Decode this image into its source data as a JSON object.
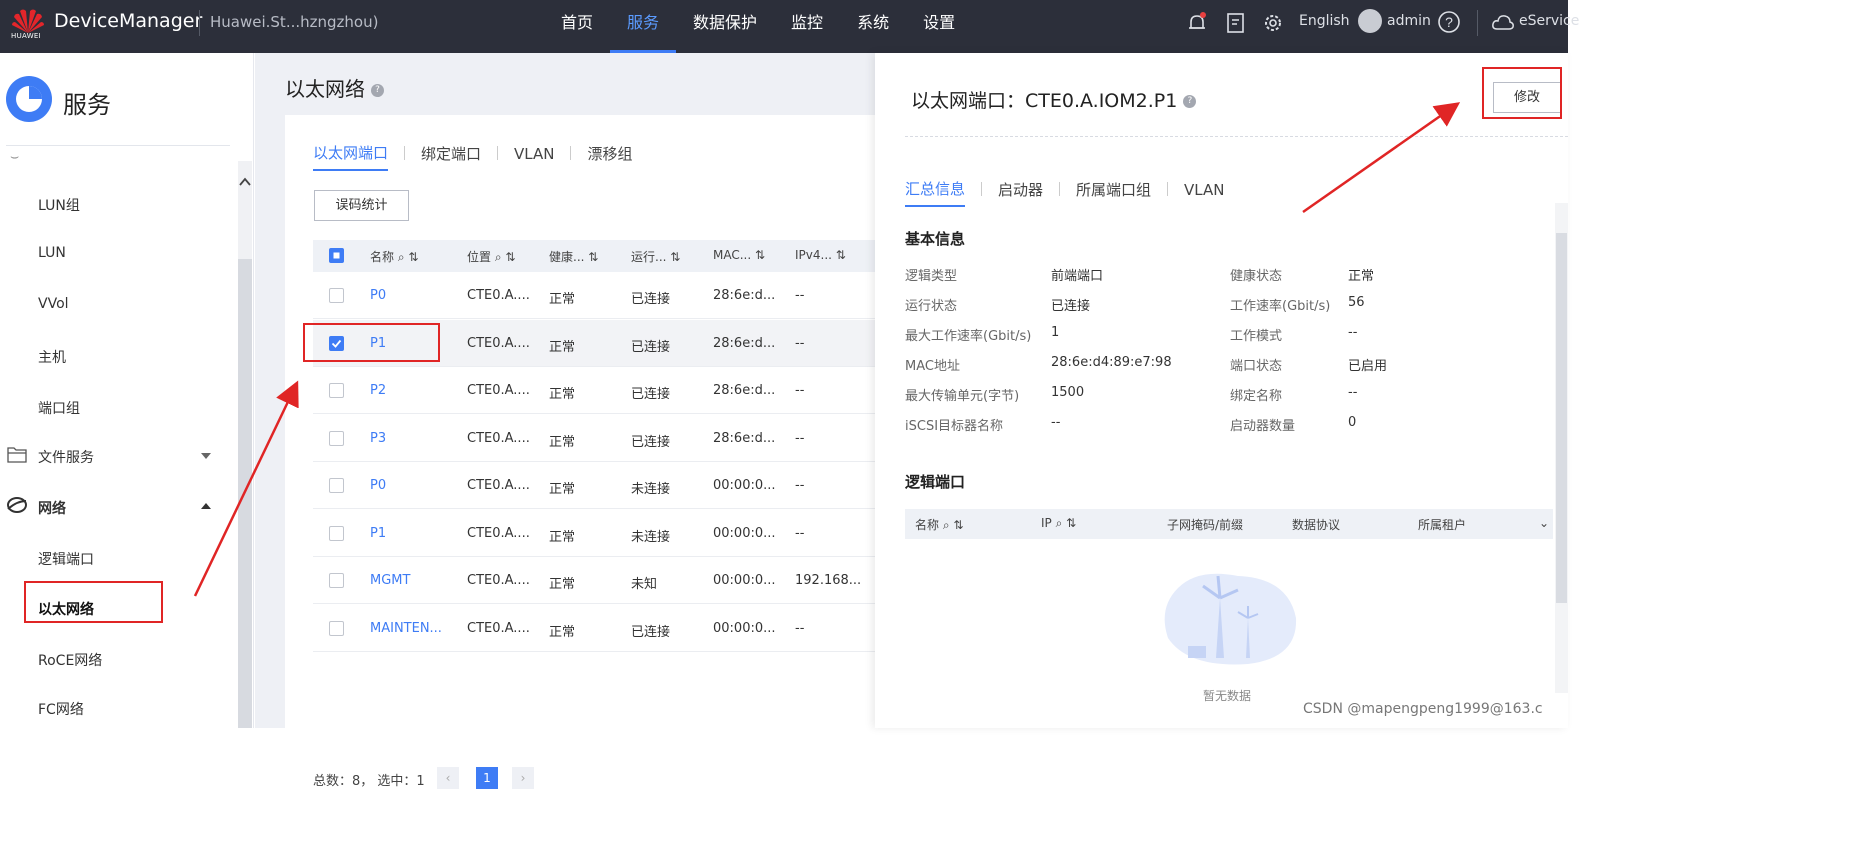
{
  "topbar": {
    "brand": "HUAWEI",
    "app_title": "DeviceManager",
    "device_name": "Huawei.St...hzngzhou)",
    "nav": [
      "首页",
      "服务",
      "数据保护",
      "监控",
      "系统",
      "设置"
    ],
    "active_nav": "服务",
    "language": "English",
    "user": "admin",
    "eservice": "eService"
  },
  "sidebar": {
    "title": "服务",
    "items": [
      "LUN组",
      "LUN",
      "VVol",
      "主机",
      "端口组"
    ],
    "file_service": "文件服务",
    "network": "网络",
    "network_items": [
      "逻辑端口",
      "以太网络",
      "RoCE网络",
      "FC网络"
    ],
    "active_item": "以太网络"
  },
  "main": {
    "title": "以太网络",
    "tabs": [
      "以太网端口",
      "绑定端口",
      "VLAN",
      "漂移组"
    ],
    "active_tab": "以太网端口",
    "error_stats_button": "误码统计",
    "columns": [
      "名称",
      "位置",
      "健康...",
      "运行...",
      "MAC...",
      "IPv4..."
    ],
    "rows": [
      {
        "name": "P0",
        "location": "CTE0.A....",
        "health": "正常",
        "running": "已连接",
        "mac": "28:6e:d...",
        "ipv4": "--",
        "checked": false
      },
      {
        "name": "P1",
        "location": "CTE0.A....",
        "health": "正常",
        "running": "已连接",
        "mac": "28:6e:d...",
        "ipv4": "--",
        "checked": true
      },
      {
        "name": "P2",
        "location": "CTE0.A....",
        "health": "正常",
        "running": "已连接",
        "mac": "28:6e:d...",
        "ipv4": "--",
        "checked": false
      },
      {
        "name": "P3",
        "location": "CTE0.A....",
        "health": "正常",
        "running": "已连接",
        "mac": "28:6e:d...",
        "ipv4": "--",
        "checked": false
      },
      {
        "name": "P0",
        "location": "CTE0.A....",
        "health": "正常",
        "running": "未连接",
        "mac": "00:00:0...",
        "ipv4": "--",
        "checked": false
      },
      {
        "name": "P1",
        "location": "CTE0.A....",
        "health": "正常",
        "running": "未连接",
        "mac": "00:00:0...",
        "ipv4": "--",
        "checked": false
      },
      {
        "name": "MGMT",
        "location": "CTE0.A....",
        "health": "正常",
        "running": "未知",
        "mac": "00:00:0...",
        "ipv4": "192.168...",
        "checked": false
      },
      {
        "name": "MAINTEN...",
        "location": "CTE0.A....",
        "health": "正常",
        "running": "已连接",
        "mac": "00:00:0...",
        "ipv4": "--",
        "checked": false
      }
    ],
    "footer": "总数：8，  选中：1",
    "page": "1"
  },
  "panel": {
    "title": "以太网端口：CTE0.A.IOM2.P1",
    "edit_button": "修改",
    "tabs": [
      "汇总信息",
      "启动器",
      "所属端口组",
      "VLAN"
    ],
    "active_tab": "汇总信息",
    "basic_info_title": "基本信息",
    "left_fields": [
      {
        "k": "逻辑类型",
        "v": "前端端口"
      },
      {
        "k": "运行状态",
        "v": "已连接"
      },
      {
        "k": "最大工作速率(Gbit/s)",
        "v": "1"
      },
      {
        "k": "MAC地址",
        "v": "28:6e:d4:89:e7:98"
      },
      {
        "k": "最大传输单元(字节)",
        "v": "1500"
      },
      {
        "k": "iSCSI目标器名称",
        "v": "--"
      }
    ],
    "right_fields": [
      {
        "k": "健康状态",
        "v": "正常"
      },
      {
        "k": "工作速率(Gbit/s)",
        "v": "56"
      },
      {
        "k": "工作模式",
        "v": "--"
      },
      {
        "k": "端口状态",
        "v": "已启用"
      },
      {
        "k": "绑定名称",
        "v": "--"
      },
      {
        "k": "启动器数量",
        "v": "0"
      }
    ],
    "logical_ports_title": "逻辑端口",
    "lp_columns": [
      "名称",
      "IP",
      "子网掩码/前缀",
      "数据协议",
      "所属租户"
    ],
    "empty_text": "暂无数据"
  },
  "watermark": "CSDN @mapengpeng1999@163.c",
  "colors": {
    "accent": "#3e7cf5",
    "topbar": "#2c2f3a",
    "annotation": "#e02525"
  }
}
